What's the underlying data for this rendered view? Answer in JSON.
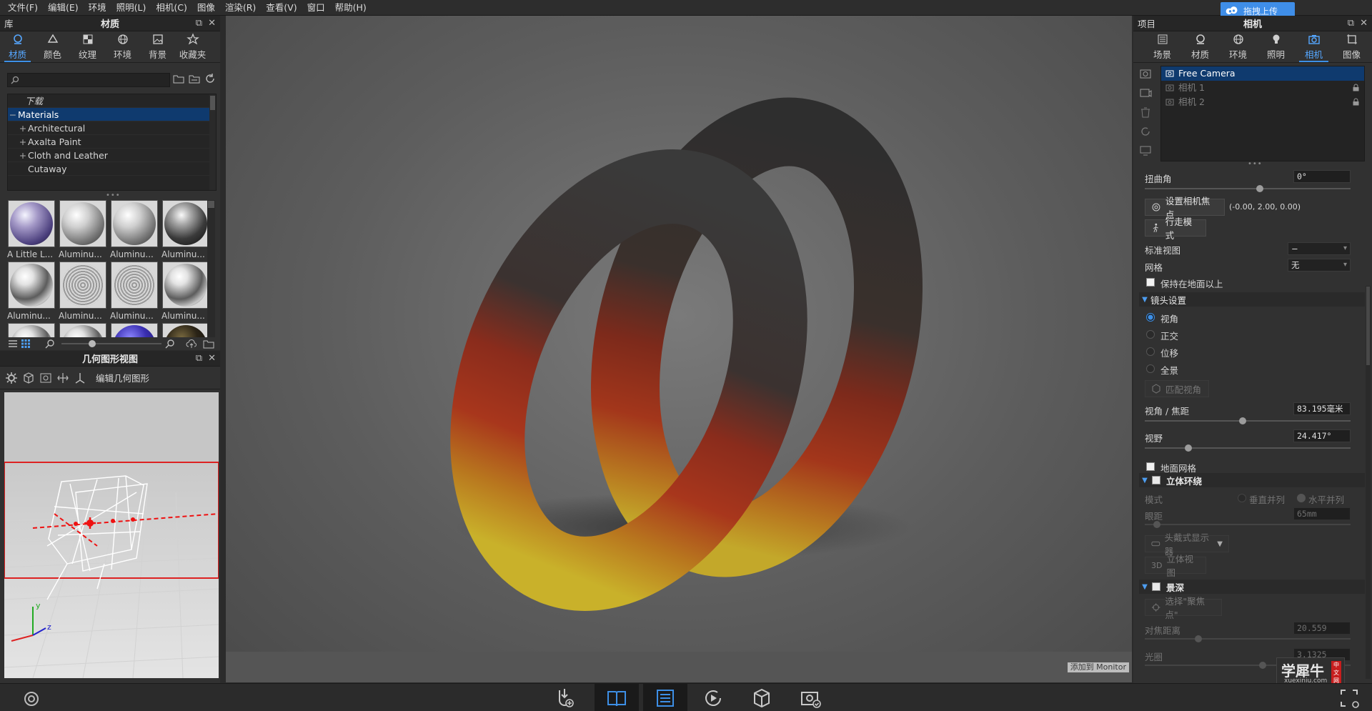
{
  "menu": [
    "文件(F)",
    "编辑(E)",
    "环境",
    "照明(L)",
    "相机(C)",
    "图像",
    "渲染(R)",
    "查看(V)",
    "窗口",
    "帮助(H)"
  ],
  "upload_label": "拖拽上传",
  "library": {
    "header_left": "库",
    "title": "材质",
    "tabs": [
      "材质",
      "颜色",
      "纹理",
      "环境",
      "背景",
      "收藏夹"
    ],
    "active_tab": 0,
    "search_value": "",
    "tree": [
      {
        "label": "下载",
        "pm": "",
        "style": "italic"
      },
      {
        "label": "Materials",
        "pm": "−",
        "style": "selected"
      },
      {
        "label": "Architectural",
        "pm": "+",
        "style": "child"
      },
      {
        "label": "Axalta Paint",
        "pm": "+",
        "style": "child"
      },
      {
        "label": "Cloth and Leather",
        "pm": "+",
        "style": "child"
      },
      {
        "label": "Cutaway",
        "pm": "",
        "style": "child"
      }
    ],
    "thumbnails": [
      {
        "label": "A Little L...",
        "color": "purple"
      },
      {
        "label": "Aluminu...",
        "color": "silver"
      },
      {
        "label": "Aluminu...",
        "color": "silver"
      },
      {
        "label": "Aluminu...",
        "color": "dark"
      },
      {
        "label": "Aluminu...",
        "color": "chrome"
      },
      {
        "label": "Aluminu...",
        "color": "mesh"
      },
      {
        "label": "Aluminu...",
        "color": "mesh"
      },
      {
        "label": "Aluminu...",
        "color": "chrome"
      },
      {
        "label": "",
        "color": "chrome"
      },
      {
        "label": "",
        "color": "chrome"
      },
      {
        "label": "",
        "color": "blue"
      },
      {
        "label": "",
        "color": "black"
      }
    ]
  },
  "geometry": {
    "title": "几何图形视图",
    "edit_label": "编辑几何图形"
  },
  "viewport": {
    "monitor_label": "添加到 Monitor"
  },
  "project": {
    "header_left": "项目",
    "title": "相机",
    "tabs": [
      "场景",
      "材质",
      "环境",
      "照明",
      "相机",
      "图像"
    ],
    "active_tab": 4,
    "cameras": [
      {
        "label": "Free Camera",
        "selected": true,
        "locked": false
      },
      {
        "label": "相机 1",
        "selected": false,
        "locked": true
      },
      {
        "label": "相机 2",
        "selected": false,
        "locked": true
      }
    ],
    "twist_label": "扭曲角",
    "twist_value": "0°",
    "set_focus_label": "设置相机焦点",
    "focus_coords": "(-0.00, 2.00, 0.00)",
    "walk_label": "行走模式",
    "standard_view_label": "标准视图",
    "standard_view_value": "−",
    "grid_label": "网格",
    "grid_value": "无",
    "keep_above_label": "保持在地面以上",
    "lens_section": "镜头设置",
    "lens_options": [
      "视角",
      "正交",
      "位移",
      "全景"
    ],
    "lens_selected": 0,
    "match_view_label": "匹配视角",
    "fov_focal_label": "视角 / 焦距",
    "fov_focal_value": "83.195毫米",
    "fov_label": "视野",
    "fov_value": "24.417°",
    "ground_grid_label": "地面网格",
    "stereo_section": "立体环绕",
    "mode_label": "模式",
    "mode_vertical": "垂直并列",
    "mode_horizontal": "水平并列",
    "eye_distance_label": "眼距",
    "eye_distance_value": "65mm",
    "hmd_label": "头戴式显示器",
    "stereo_view_label": "立体视图",
    "dof_section": "景深",
    "select_focus_label": "选择\"聚焦点\"",
    "focus_distance_label": "对焦距离",
    "focus_distance_value": "20.559",
    "aperture_label": "光圈",
    "aperture_value": "3.1325"
  },
  "watermark": {
    "main": "学犀牛",
    "sub": "xuexiniu.com",
    "tag": "中文网"
  }
}
